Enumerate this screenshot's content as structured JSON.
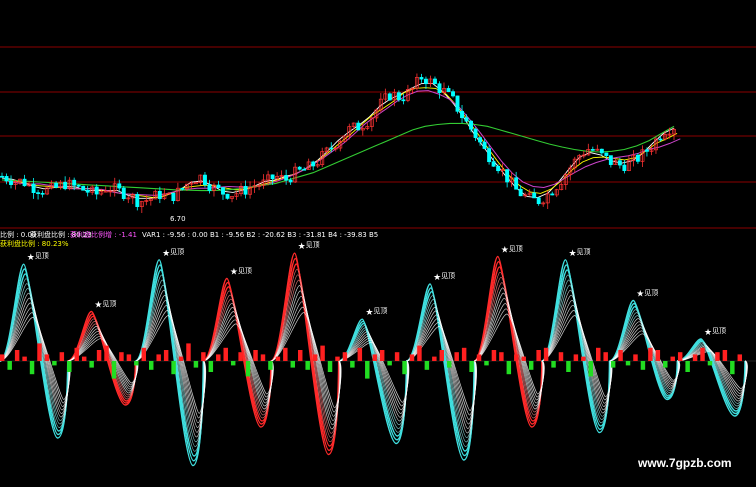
{
  "header": {
    "ratio_label": "比例 : 0.00",
    "profit_label": "获利盘比例 : 80.23",
    "profit_change_label": "获利盘比例增 : -1.41",
    "profit_pct_label": "获利盘比例 : 80.23%",
    "var_readout": "VAR1 : -9.56 : 0.00 B1 : -9.56 B2 : -20.62 B3 : -31.81 B4 : -39.83 B5"
  },
  "price_annotations": {
    "low_price": "6.70"
  },
  "signal_label": "见顶",
  "watermark": "www.7gpzb.com",
  "colors": {
    "background": "#000000",
    "grid": "#8b0000",
    "up_candle": "#ff3333",
    "down_candle": "#00ffff",
    "ma_short": "#ffffff",
    "ma_mid": "#ffff00",
    "ma_purple": "#cc44cc",
    "ma_long": "#33cc33",
    "wave_cyan": "#40e0e0",
    "wave_red": "#ff2a2a",
    "wave_white": "#ffffff",
    "hist_red": "#ff2020",
    "hist_green": "#22dd22"
  },
  "chart_data": [
    {
      "type": "candlestick",
      "title": "",
      "series": [
        {
          "name": "",
          "points_yprice": "candles drawn from generated OHLC path"
        }
      ],
      "price_path": [
        5.6,
        5.5,
        5.45,
        5.3,
        5.2,
        5.25,
        5.4,
        5.3,
        5.2,
        5.1,
        5.3,
        5.2,
        5.1,
        4.9,
        4.95,
        5.1,
        5.0,
        5.2,
        5.5,
        5.6,
        5.3,
        5.15,
        5.1,
        5.2,
        5.35,
        5.4,
        5.6,
        5.5,
        5.7,
        5.8,
        6.0,
        6.3,
        6.6,
        6.9,
        7.0,
        7.2,
        7.6,
        7.9,
        7.8,
        8.0,
        8.4,
        8.2,
        8.0,
        7.7,
        7.2,
        6.8,
        6.3,
        6.0,
        5.6,
        5.2,
        5.0,
        4.9,
        5.1,
        5.4,
        5.8,
        6.2,
        6.4,
        6.2,
        6.0,
        5.9,
        6.0,
        6.2,
        6.5,
        6.9,
        7.0
      ],
      "ma_long_path": [
        5.5,
        5.48,
        5.46,
        5.44,
        5.42,
        5.4,
        5.38,
        5.36,
        5.34,
        5.32,
        5.3,
        5.28,
        5.26,
        5.24,
        5.22,
        5.21,
        5.2,
        5.2,
        5.22,
        5.25,
        5.3,
        5.35,
        5.4,
        5.5,
        5.6,
        5.7,
        5.85,
        6.0,
        6.15,
        6.3,
        6.45,
        6.6,
        6.75,
        6.9,
        7.0,
        7.05,
        7.08,
        7.08,
        7.05,
        7.0,
        6.9,
        6.8,
        6.7,
        6.6,
        6.5,
        6.42,
        6.35,
        6.3,
        6.28,
        6.3,
        6.35,
        6.45,
        6.6,
        6.8,
        7.0
      ]
    },
    {
      "type": "area",
      "title": "",
      "waves": [
        {
          "peak": 0.88,
          "trough": -0.7,
          "dir": "cyan"
        },
        {
          "peak": 0.45,
          "trough": -0.4,
          "dir": "red"
        },
        {
          "peak": 0.92,
          "trough": -0.95,
          "dir": "cyan"
        },
        {
          "peak": 0.75,
          "trough": -0.6,
          "dir": "red"
        },
        {
          "peak": 0.98,
          "trough": -0.85,
          "dir": "red"
        },
        {
          "peak": 0.38,
          "trough": -0.75,
          "dir": "cyan"
        },
        {
          "peak": 0.7,
          "trough": -0.9,
          "dir": "cyan"
        },
        {
          "peak": 0.95,
          "trough": -0.6,
          "dir": "red"
        },
        {
          "peak": 0.92,
          "trough": -0.65,
          "dir": "cyan"
        },
        {
          "peak": 0.55,
          "trough": -0.35,
          "dir": "cyan"
        },
        {
          "peak": 0.2,
          "trough": -0.5,
          "dir": "cyan"
        }
      ],
      "histogram": [
        3,
        -4,
        5,
        2,
        -6,
        8,
        3,
        -2,
        4,
        -5,
        6,
        2,
        -3,
        5,
        7,
        -8,
        4,
        3,
        -2,
        6,
        -4,
        3,
        5,
        -6,
        2,
        8,
        -3,
        4,
        -5,
        3,
        6,
        -2,
        4,
        -7,
        5,
        3,
        -4,
        2,
        6,
        -3,
        5,
        -4,
        3,
        7,
        -5,
        2,
        4,
        -3,
        6,
        -8,
        3,
        5,
        -2,
        4,
        -6,
        3,
        7,
        -4,
        2,
        5,
        -3,
        4,
        6,
        -5,
        3,
        -2,
        5,
        4,
        -6,
        3,
        2,
        -4,
        5,
        6,
        -3,
        4,
        -5,
        3,
        2,
        -7,
        6,
        4,
        -3,
        5,
        -2,
        3,
        -4,
        6,
        5,
        -3,
        2,
        4,
        -5,
        3,
        6,
        -2,
        4,
        5,
        -6,
        3
      ]
    }
  ]
}
